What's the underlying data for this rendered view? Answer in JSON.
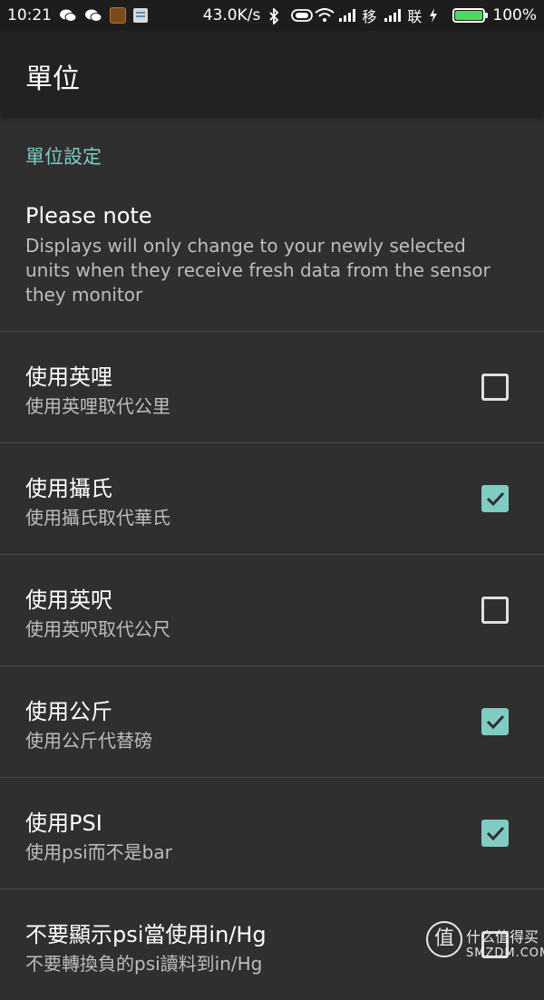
{
  "status_bar": {
    "time": "10:21",
    "speed": "43.0K/s",
    "carrier1": "移",
    "carrier2": "联",
    "battery": "100%",
    "battery_color": "#4cd964",
    "icons": [
      "wechat-icon",
      "wechat-icon",
      "game-app-icon",
      "document-icon",
      "bluetooth-icon",
      "toggle-icon",
      "wifi-icon",
      "signal-icon",
      "signal-icon",
      "charging-icon",
      "battery-icon"
    ]
  },
  "toolbar": {
    "title": "單位"
  },
  "category": {
    "title": "單位設定"
  },
  "note": {
    "title": "Please note",
    "summary": "Displays will only change to your newly selected units when they receive fresh data from the sensor they monitor"
  },
  "preferences": [
    {
      "title": "使用英哩",
      "summary": "使用英哩取代公里",
      "checked": false
    },
    {
      "title": "使用攝氏",
      "summary": "使用攝氏取代華氏",
      "checked": true
    },
    {
      "title": "使用英呎",
      "summary": "使用英呎取代公尺",
      "checked": false
    },
    {
      "title": "使用公斤",
      "summary": "使用公斤代替磅",
      "checked": true
    },
    {
      "title": "使用PSI",
      "summary": "使用psi而不是bar",
      "checked": true
    },
    {
      "title": "不要顯示psi當使用in/Hg",
      "summary": "不要轉換負的psi讀料到in/Hg",
      "checked": false
    }
  ],
  "watermark": {
    "logo_char": "值",
    "line1": "什么值得买",
    "line2": "SMZDM.COM"
  },
  "colors": {
    "accent": "#80cbc4",
    "background": "#2f2f2f",
    "toolbar": "#222222",
    "status_bar": "#1d1d1d"
  }
}
